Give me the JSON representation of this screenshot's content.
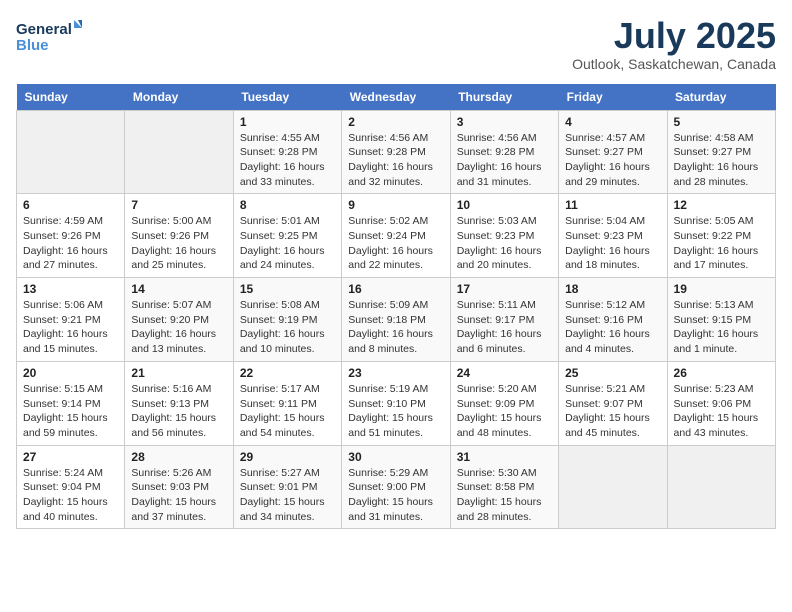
{
  "logo": {
    "line1": "General",
    "line2": "Blue"
  },
  "title": "July 2025",
  "location": "Outlook, Saskatchewan, Canada",
  "weekdays": [
    "Sunday",
    "Monday",
    "Tuesday",
    "Wednesday",
    "Thursday",
    "Friday",
    "Saturday"
  ],
  "weeks": [
    [
      {
        "num": "",
        "info": ""
      },
      {
        "num": "",
        "info": ""
      },
      {
        "num": "1",
        "info": "Sunrise: 4:55 AM\nSunset: 9:28 PM\nDaylight: 16 hours\nand 33 minutes."
      },
      {
        "num": "2",
        "info": "Sunrise: 4:56 AM\nSunset: 9:28 PM\nDaylight: 16 hours\nand 32 minutes."
      },
      {
        "num": "3",
        "info": "Sunrise: 4:56 AM\nSunset: 9:28 PM\nDaylight: 16 hours\nand 31 minutes."
      },
      {
        "num": "4",
        "info": "Sunrise: 4:57 AM\nSunset: 9:27 PM\nDaylight: 16 hours\nand 29 minutes."
      },
      {
        "num": "5",
        "info": "Sunrise: 4:58 AM\nSunset: 9:27 PM\nDaylight: 16 hours\nand 28 minutes."
      }
    ],
    [
      {
        "num": "6",
        "info": "Sunrise: 4:59 AM\nSunset: 9:26 PM\nDaylight: 16 hours\nand 27 minutes."
      },
      {
        "num": "7",
        "info": "Sunrise: 5:00 AM\nSunset: 9:26 PM\nDaylight: 16 hours\nand 25 minutes."
      },
      {
        "num": "8",
        "info": "Sunrise: 5:01 AM\nSunset: 9:25 PM\nDaylight: 16 hours\nand 24 minutes."
      },
      {
        "num": "9",
        "info": "Sunrise: 5:02 AM\nSunset: 9:24 PM\nDaylight: 16 hours\nand 22 minutes."
      },
      {
        "num": "10",
        "info": "Sunrise: 5:03 AM\nSunset: 9:23 PM\nDaylight: 16 hours\nand 20 minutes."
      },
      {
        "num": "11",
        "info": "Sunrise: 5:04 AM\nSunset: 9:23 PM\nDaylight: 16 hours\nand 18 minutes."
      },
      {
        "num": "12",
        "info": "Sunrise: 5:05 AM\nSunset: 9:22 PM\nDaylight: 16 hours\nand 17 minutes."
      }
    ],
    [
      {
        "num": "13",
        "info": "Sunrise: 5:06 AM\nSunset: 9:21 PM\nDaylight: 16 hours\nand 15 minutes."
      },
      {
        "num": "14",
        "info": "Sunrise: 5:07 AM\nSunset: 9:20 PM\nDaylight: 16 hours\nand 13 minutes."
      },
      {
        "num": "15",
        "info": "Sunrise: 5:08 AM\nSunset: 9:19 PM\nDaylight: 16 hours\nand 10 minutes."
      },
      {
        "num": "16",
        "info": "Sunrise: 5:09 AM\nSunset: 9:18 PM\nDaylight: 16 hours\nand 8 minutes."
      },
      {
        "num": "17",
        "info": "Sunrise: 5:11 AM\nSunset: 9:17 PM\nDaylight: 16 hours\nand 6 minutes."
      },
      {
        "num": "18",
        "info": "Sunrise: 5:12 AM\nSunset: 9:16 PM\nDaylight: 16 hours\nand 4 minutes."
      },
      {
        "num": "19",
        "info": "Sunrise: 5:13 AM\nSunset: 9:15 PM\nDaylight: 16 hours\nand 1 minute."
      }
    ],
    [
      {
        "num": "20",
        "info": "Sunrise: 5:15 AM\nSunset: 9:14 PM\nDaylight: 15 hours\nand 59 minutes."
      },
      {
        "num": "21",
        "info": "Sunrise: 5:16 AM\nSunset: 9:13 PM\nDaylight: 15 hours\nand 56 minutes."
      },
      {
        "num": "22",
        "info": "Sunrise: 5:17 AM\nSunset: 9:11 PM\nDaylight: 15 hours\nand 54 minutes."
      },
      {
        "num": "23",
        "info": "Sunrise: 5:19 AM\nSunset: 9:10 PM\nDaylight: 15 hours\nand 51 minutes."
      },
      {
        "num": "24",
        "info": "Sunrise: 5:20 AM\nSunset: 9:09 PM\nDaylight: 15 hours\nand 48 minutes."
      },
      {
        "num": "25",
        "info": "Sunrise: 5:21 AM\nSunset: 9:07 PM\nDaylight: 15 hours\nand 45 minutes."
      },
      {
        "num": "26",
        "info": "Sunrise: 5:23 AM\nSunset: 9:06 PM\nDaylight: 15 hours\nand 43 minutes."
      }
    ],
    [
      {
        "num": "27",
        "info": "Sunrise: 5:24 AM\nSunset: 9:04 PM\nDaylight: 15 hours\nand 40 minutes."
      },
      {
        "num": "28",
        "info": "Sunrise: 5:26 AM\nSunset: 9:03 PM\nDaylight: 15 hours\nand 37 minutes."
      },
      {
        "num": "29",
        "info": "Sunrise: 5:27 AM\nSunset: 9:01 PM\nDaylight: 15 hours\nand 34 minutes."
      },
      {
        "num": "30",
        "info": "Sunrise: 5:29 AM\nSunset: 9:00 PM\nDaylight: 15 hours\nand 31 minutes."
      },
      {
        "num": "31",
        "info": "Sunrise: 5:30 AM\nSunset: 8:58 PM\nDaylight: 15 hours\nand 28 minutes."
      },
      {
        "num": "",
        "info": ""
      },
      {
        "num": "",
        "info": ""
      }
    ]
  ]
}
